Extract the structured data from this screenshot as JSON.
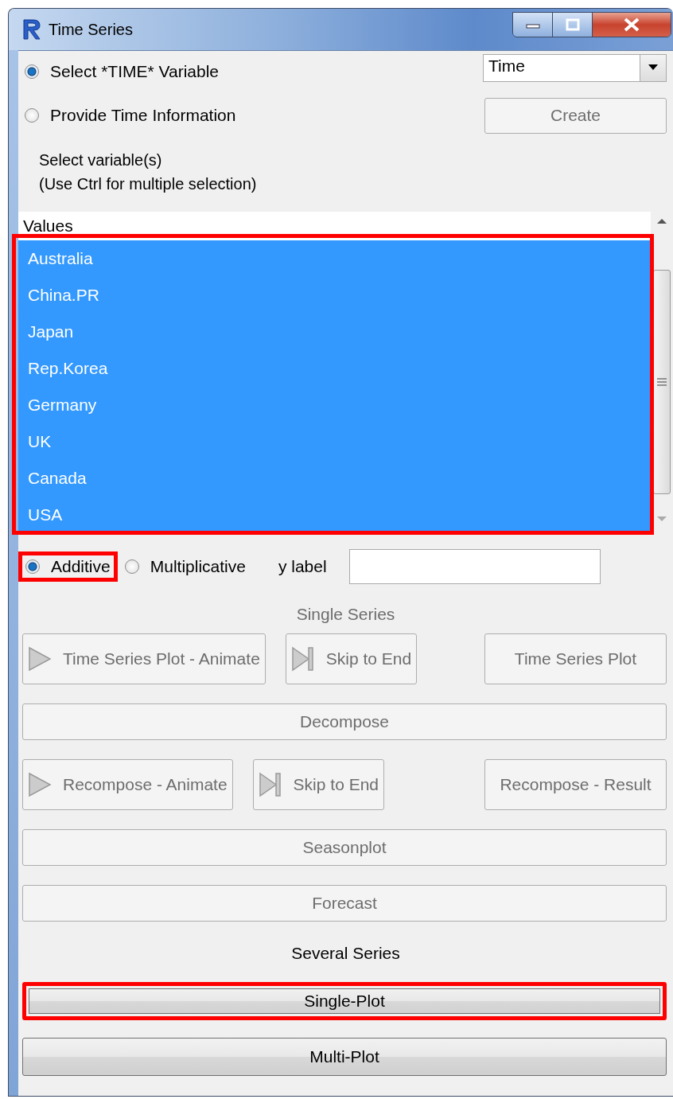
{
  "window": {
    "title": "Time Series"
  },
  "time_source": [
    {
      "label": "Select *TIME* Variable",
      "selected": true
    },
    {
      "label": "Provide Time Information",
      "selected": false
    }
  ],
  "time_dropdown": {
    "value": "Time"
  },
  "create_button": {
    "label": "Create",
    "disabled": true
  },
  "instructions": [
    "Select variable(s)",
    "(Use Ctrl for multiple selection)"
  ],
  "variable_list": {
    "highlighted": true,
    "items": [
      {
        "label": "Values",
        "selected": false
      },
      {
        "label": "Australia",
        "selected": true
      },
      {
        "label": "China.PR",
        "selected": true
      },
      {
        "label": "Japan",
        "selected": true
      },
      {
        "label": "Rep.Korea",
        "selected": true
      },
      {
        "label": "Germany",
        "selected": true
      },
      {
        "label": "UK",
        "selected": true
      },
      {
        "label": "Canada",
        "selected": true
      },
      {
        "label": "USA",
        "selected": true
      }
    ]
  },
  "model": [
    {
      "label": "Additive",
      "selected": true,
      "highlighted": true
    },
    {
      "label": "Multiplicative",
      "selected": false,
      "highlighted": false
    }
  ],
  "y_label": {
    "label": "y label"
  },
  "sections": [
    {
      "heading": "Single Series",
      "disabled": true,
      "rows": [
        [
          {
            "label": "Time Series Plot - Animate",
            "kind": "play",
            "disabled": true,
            "highlighted": false
          },
          {
            "label": "Skip to End",
            "kind": "skip",
            "disabled": true,
            "highlighted": false
          },
          {
            "label": "Time Series Plot",
            "kind": "plain",
            "disabled": true,
            "highlighted": false
          }
        ],
        [
          {
            "label": "Decompose",
            "kind": "plain",
            "disabled": true,
            "highlighted": false
          }
        ],
        [
          {
            "label": "Recompose - Animate",
            "kind": "play",
            "disabled": true,
            "highlighted": false
          },
          {
            "label": "Skip to End",
            "kind": "skip",
            "disabled": true,
            "highlighted": false
          },
          {
            "label": "Recompose - Result",
            "kind": "plain",
            "disabled": true,
            "highlighted": false
          }
        ],
        [
          {
            "label": "Seasonplot",
            "kind": "plain",
            "disabled": true,
            "highlighted": false
          }
        ],
        [
          {
            "label": "Forecast",
            "kind": "plain",
            "disabled": true,
            "highlighted": false
          }
        ]
      ]
    },
    {
      "heading": "Several Series",
      "disabled": false,
      "rows": [
        [
          {
            "label": "Single-Plot",
            "kind": "plain",
            "disabled": false,
            "highlighted": true
          }
        ],
        [
          {
            "label": "Multi-Plot",
            "kind": "plain",
            "disabled": false,
            "highlighted": false
          }
        ]
      ]
    }
  ]
}
